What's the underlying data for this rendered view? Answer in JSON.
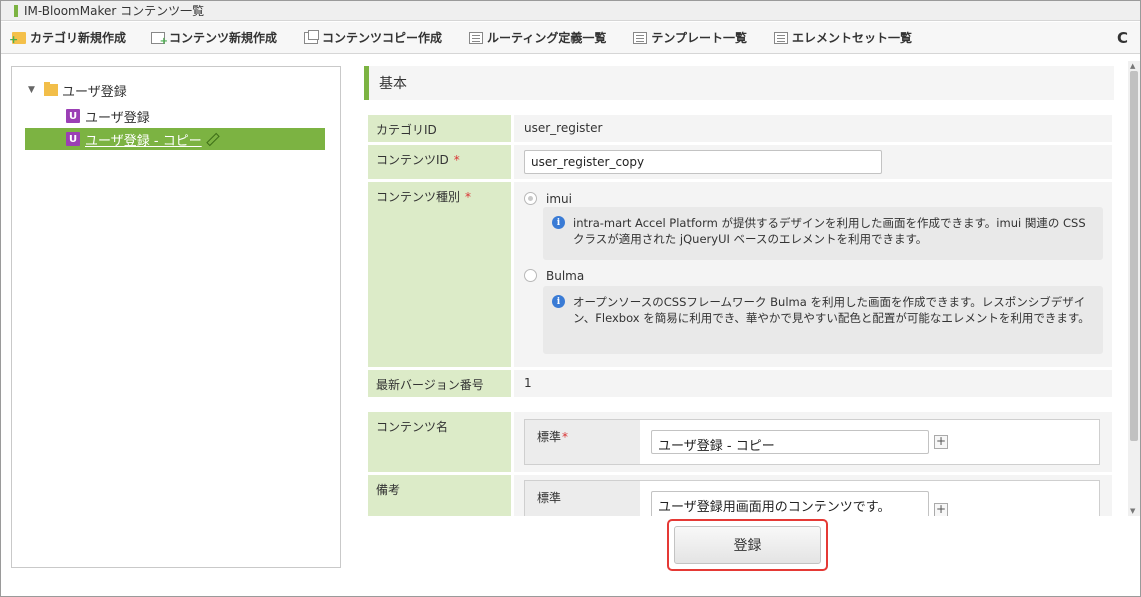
{
  "window": {
    "title": "IM-BloomMaker コンテンツ一覧"
  },
  "toolbar": {
    "items": [
      {
        "label": "カテゴリ新規作成",
        "icon": "folder-add-icon"
      },
      {
        "label": "コンテンツ新規作成",
        "icon": "document-add-icon"
      },
      {
        "label": "コンテンツコピー作成",
        "icon": "copy-icon"
      },
      {
        "label": "ルーティング定義一覧",
        "icon": "list-icon"
      },
      {
        "label": "テンプレート一覧",
        "icon": "list-icon"
      },
      {
        "label": "エレメントセット一覧",
        "icon": "list-icon"
      }
    ],
    "refresh_icon": "C"
  },
  "tree": {
    "folder_label": "ユーザ登録",
    "items": [
      {
        "label": "ユーザ登録",
        "badge": "U"
      },
      {
        "label": "ユーザ登録 - コピー",
        "badge": "U",
        "selected": true
      }
    ]
  },
  "form": {
    "section_title": "基本",
    "category_id": {
      "label": "カテゴリID",
      "value": "user_register"
    },
    "content_id": {
      "label": "コンテンツID",
      "value": "user_register_copy"
    },
    "content_type": {
      "label": "コンテンツ種別",
      "options": [
        {
          "label": "imui",
          "selected": true,
          "description": "intra-mart Accel Platform が提供するデザインを利用した画面を作成できます。imui 関連の CSS クラスが適用された jQueryUI ベースのエレメントを利用できます。"
        },
        {
          "label": "Bulma",
          "selected": false,
          "description": "オープンソースのCSSフレームワーク Bulma を利用した画面を作成できます。レスポンシブデザイン、Flexbox を簡易に利用でき、華やかで見やすい配色と配置が可能なエレメントを利用できます。"
        }
      ]
    },
    "latest_version": {
      "label": "最新バージョン番号",
      "value": "1"
    },
    "content_name": {
      "label": "コンテンツ名",
      "sub_label": "標準",
      "value": "ユーザ登録 - コピー"
    },
    "remarks": {
      "label": "備考",
      "sub_label": "標準",
      "value": "ユーザ登録用画面用のコンテンツです。"
    },
    "required_mark": "*",
    "plus": "+"
  },
  "actions": {
    "register_label": "登録"
  },
  "colors": {
    "accent_green": "#7cb342",
    "label_green": "#dcebc8",
    "highlight_red": "#e53935",
    "badge_purple": "#9b3fb5"
  }
}
